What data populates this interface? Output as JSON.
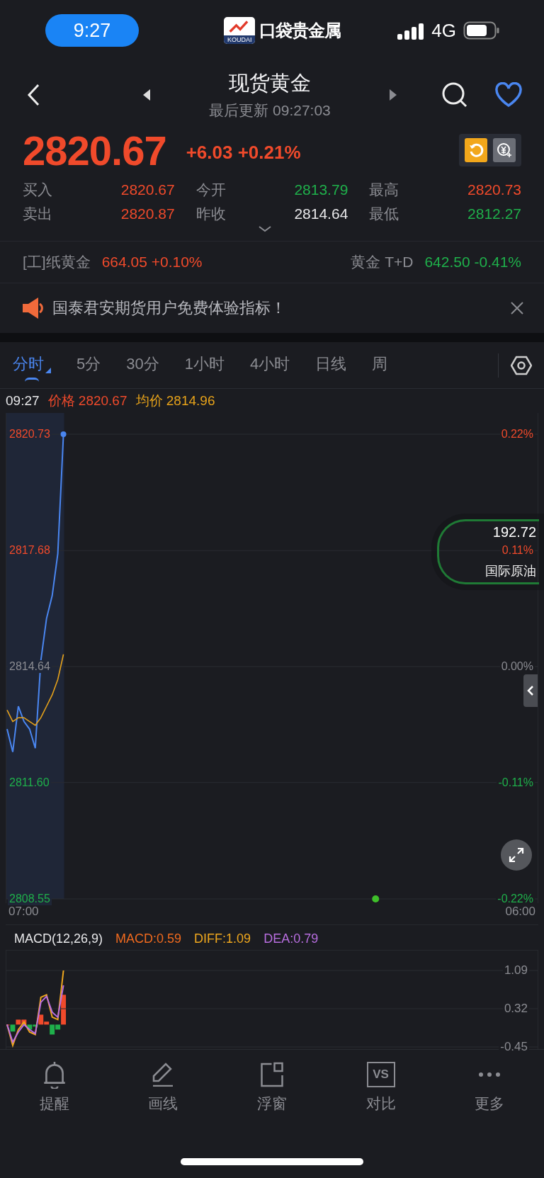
{
  "status_bar": {
    "time": "9:27",
    "app_name": "口袋贵金属",
    "app_badge": "KOUDAI",
    "network": "4G"
  },
  "header": {
    "title": "现货黄金",
    "subtitle": "最后更新 09:27:03",
    "favorite": true
  },
  "quote": {
    "price": "2820.67",
    "change": "+6.03 +0.21%"
  },
  "stats": [
    {
      "label": "买入",
      "value": "2820.67",
      "color": "#f04a2b"
    },
    {
      "label": "今开",
      "value": "2813.79",
      "color": "#1fb04b"
    },
    {
      "label": "最高",
      "value": "2820.73",
      "color": "#f04a2b"
    },
    {
      "label": "卖出",
      "value": "2820.87",
      "color": "#f04a2b"
    },
    {
      "label": "昨收",
      "value": "2814.64",
      "color": "#e8e8ea"
    },
    {
      "label": "最低",
      "value": "2812.27",
      "color": "#1fb04b"
    }
  ],
  "related": [
    {
      "name": "[工]纸黄金",
      "quote": "664.05 +0.10%",
      "color": "#f04a2b"
    },
    {
      "name": "黄金 T+D",
      "quote": "642.50 -0.41%",
      "color": "#1fb04b"
    }
  ],
  "banner": {
    "text": "国泰君安期货用户免费体验指标！"
  },
  "tabs": [
    {
      "label": "分时",
      "selected": true
    },
    {
      "label": "5分",
      "selected": false
    },
    {
      "label": "30分",
      "selected": false
    },
    {
      "label": "1小时",
      "selected": false
    },
    {
      "label": "4小时",
      "selected": false
    },
    {
      "label": "日线",
      "selected": false
    },
    {
      "label": "周",
      "selected": false
    }
  ],
  "chart_header": {
    "time": "09:27",
    "price": "2820.67",
    "average": "2814.96"
  },
  "main_chart": {
    "overlay_quote": {
      "value": "192.72",
      "name": "国际原油"
    },
    "time_labels": [
      "07:00",
      "06:00"
    ],
    "percent_labels": [
      "0.22%",
      "0.11%",
      "0.00%",
      "-0.11%",
      "-0.22%"
    ],
    "chart_data": {
      "type": "line",
      "grid": true,
      "categories": [
        null,
        null,
        null,
        null,
        null,
        null,
        null,
        null,
        null,
        null,
        null,
        null,
        null,
        null,
        null,
        null,
        null,
        null,
        null,
        null,
        null,
        null,
        null,
        null,
        null,
        null,
        null,
        null,
        null,
        null,
        null,
        null,
        null,
        null,
        null,
        null,
        null,
        null,
        null,
        null,
        null,
        null,
        null,
        null,
        null,
        null,
        null,
        null,
        null,
        null,
        null,
        null,
        null,
        null,
        null,
        null,
        null,
        null,
        null,
        null,
        null,
        null,
        null,
        null,
        null,
        null,
        null,
        null,
        null,
        null,
        null,
        null,
        null,
        null,
        null,
        null,
        null,
        null,
        null,
        null,
        null,
        null,
        null,
        null,
        null,
        null,
        null,
        null,
        null,
        null,
        null,
        null,
        null,
        null,
        null
      ],
      "series": [
        {
          "name": "价格",
          "color": "#4a86f0",
          "values": [
            2813.0,
            2812.4,
            2813.6,
            2813.2,
            2813.0,
            2812.5,
            2814.8,
            2815.9,
            2816.5,
            2817.6,
            2820.73,
            null,
            null,
            null,
            null,
            null,
            null,
            null,
            null,
            null,
            null,
            null,
            null,
            null,
            null,
            null,
            null,
            null,
            null,
            null,
            null,
            null,
            null,
            null,
            null,
            null,
            null,
            null,
            null,
            null,
            null,
            null,
            null,
            null,
            null,
            null,
            null,
            null,
            null,
            null,
            null,
            null,
            null,
            null,
            null,
            null,
            null,
            null,
            null,
            null,
            null,
            null,
            null,
            null,
            null,
            null,
            null,
            null,
            null,
            null,
            null,
            null,
            null,
            null,
            null,
            null,
            null,
            null,
            null,
            null,
            null,
            null,
            null,
            null,
            null,
            null,
            null,
            null,
            null,
            null,
            null,
            null,
            null,
            null,
            null
          ]
        },
        {
          "name": "均价",
          "color": "#e6a21a",
          "values": [
            2813.5,
            2813.2,
            2813.3,
            2813.3,
            2813.2,
            2813.1,
            2813.3,
            2813.6,
            2813.9,
            2814.3,
            2814.96,
            null,
            null,
            null,
            null,
            null,
            null,
            null,
            null,
            null,
            null,
            null,
            null,
            null,
            null,
            null,
            null,
            null,
            null,
            null,
            null,
            null,
            null,
            null,
            null,
            null,
            null,
            null,
            null,
            null,
            null,
            null,
            null,
            null,
            null,
            null,
            null,
            null,
            null,
            null,
            null,
            null,
            null,
            null,
            null,
            null,
            null,
            null,
            null,
            null,
            null,
            null,
            null,
            null,
            null,
            null,
            null,
            null,
            null,
            null,
            null,
            null,
            null,
            null,
            null,
            null,
            null,
            null,
            null,
            null,
            null,
            null,
            null,
            null,
            null,
            null,
            null,
            null,
            null,
            null,
            null,
            null,
            null,
            null,
            null
          ]
        }
      ],
      "ylim": [
        2808.55,
        2820.73
      ],
      "yticks": [
        {
          "value": 2820.73,
          "label": "2820.73"
        },
        {
          "value": 2817.68,
          "label": "2817.68"
        },
        {
          "value": 2814.64,
          "label": "2814.64"
        },
        {
          "value": 2811.6,
          "label": "2811.60"
        },
        {
          "value": 2808.55,
          "label": "2808.55"
        }
      ]
    }
  },
  "macd": {
    "title": "MACD(12,26,9)",
    "macd": "MACD:0.59",
    "diff": ":1.09",
    "dea": ":0.79",
    "chart_data": {
      "type": "line",
      "grid": true,
      "categories": [
        null,
        null,
        null,
        null,
        null,
        null,
        null,
        null,
        null,
        null,
        null,
        null,
        null,
        null,
        null,
        null,
        null,
        null,
        null,
        null,
        null,
        null,
        null,
        null,
        null,
        null,
        null,
        null,
        null,
        null,
        null,
        null,
        null,
        null,
        null,
        null,
        null,
        null,
        null,
        null,
        null,
        null,
        null,
        null,
        null,
        null,
        null,
        null,
        null,
        null,
        null,
        null,
        null,
        null,
        null,
        null,
        null,
        null,
        null,
        null,
        null,
        null,
        null,
        null,
        null,
        null,
        null,
        null,
        null,
        null,
        null,
        null,
        null,
        null,
        null,
        null,
        null,
        null,
        null,
        null,
        null,
        null,
        null,
        null,
        null,
        null,
        null,
        null,
        null,
        null,
        null,
        null,
        null,
        null,
        null
      ],
      "series": [
        {
          "name": "DIFF",
          "color": "#f0a81e",
          "values": [
            0.0,
            -0.42,
            -0.1,
            0.05,
            -0.15,
            -0.2,
            0.55,
            0.6,
            0.15,
            0.1,
            1.09,
            null,
            null,
            null,
            null,
            null,
            null,
            null,
            null,
            null,
            null,
            null,
            null,
            null,
            null,
            null,
            null,
            null,
            null,
            null,
            null,
            null,
            null,
            null,
            null,
            null,
            null,
            null,
            null,
            null,
            null,
            null,
            null,
            null,
            null,
            null,
            null,
            null,
            null,
            null,
            null,
            null,
            null,
            null,
            null,
            null,
            null,
            null,
            null,
            null,
            null,
            null,
            null,
            null,
            null,
            null,
            null,
            null,
            null,
            null,
            null,
            null,
            null,
            null,
            null,
            null,
            null,
            null,
            null,
            null,
            null,
            null,
            null,
            null,
            null,
            null,
            null,
            null,
            null,
            null,
            null,
            null,
            null,
            null,
            null
          ]
        },
        {
          "name": "DEA",
          "color": "#b86ee0",
          "values": [
            0.0,
            -0.35,
            -0.15,
            0.0,
            -0.1,
            -0.18,
            0.45,
            0.57,
            0.25,
            0.15,
            0.79,
            null,
            null,
            null,
            null,
            null,
            null,
            null,
            null,
            null,
            null,
            null,
            null,
            null,
            null,
            null,
            null,
            null,
            null,
            null,
            null,
            null,
            null,
            null,
            null,
            null,
            null,
            null,
            null,
            null,
            null,
            null,
            null,
            null,
            null,
            null,
            null,
            null,
            null,
            null,
            null,
            null,
            null,
            null,
            null,
            null,
            null,
            null,
            null,
            null,
            null,
            null,
            null,
            null,
            null,
            null,
            null,
            null,
            null,
            null,
            null,
            null,
            null,
            null,
            null,
            null,
            null,
            null,
            null,
            null,
            null,
            null,
            null,
            null,
            null,
            null,
            null,
            null,
            null,
            null,
            null,
            null,
            null,
            null,
            null
          ]
        }
      ],
      "ylim": [
        -0.45,
        1.09
      ],
      "yticks": [
        1.09,
        0.32,
        -0.45
      ]
    }
  },
  "toolbar": [
    {
      "label": "提醒",
      "kind": "bell"
    },
    {
      "label": "画线",
      "kind": "pen"
    },
    {
      "label": "浮窗",
      "kind": "window"
    },
    {
      "label": "对比",
      "kind": "vs",
      "icon_text": "VS"
    },
    {
      "label": "更多",
      "kind": "more"
    }
  ]
}
